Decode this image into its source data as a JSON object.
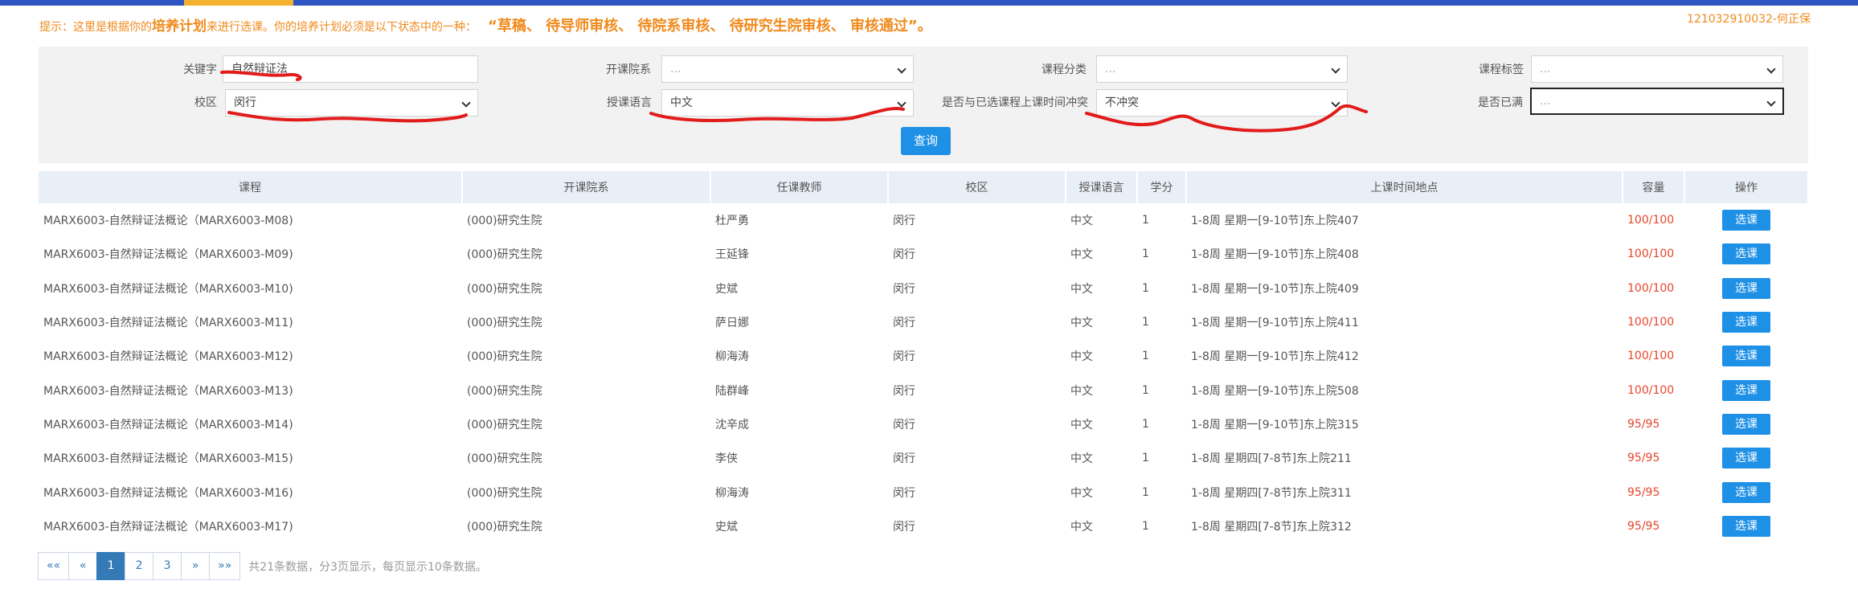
{
  "hint": {
    "prefix": "提示：这里是根据你的",
    "plan": "培养计划",
    "middle": "来进行选课。你的培养计划必须是以下状态中的一种：",
    "states": "“草稿、 待导师审核、 待院系审核、 待研究生院审核、 审核通过”。"
  },
  "user": "121032910032-何正保",
  "filters": {
    "keyword_label": "关键字",
    "keyword_value": "自然辩证法",
    "dept_label": "开课院系",
    "dept_value": "...",
    "category_label": "课程分类",
    "category_value": "...",
    "tag_label": "课程标签",
    "tag_value": "...",
    "campus_label": "校区",
    "campus_value": "闵行",
    "lang_label": "授课语言",
    "lang_value": "中文",
    "conflict_label": "是否与已选课程上课时间冲突",
    "conflict_value": "不冲突",
    "full_label": "是否已满",
    "full_value": "...",
    "query_button": "查询"
  },
  "table": {
    "headers": [
      "课程",
      "开课院系",
      "任课教师",
      "校区",
      "授课语言",
      "学分",
      "上课时间地点",
      "容量",
      "操作"
    ],
    "rows": [
      {
        "course": "MARX6003-自然辩证法概论（MARX6003-M08)",
        "dept": "(000)研究生院",
        "teacher": "杜严勇",
        "campus": "闵行",
        "lang": "中文",
        "credit": "1",
        "time": "1-8周 星期一[9-10节]东上院407",
        "cap": "100/100",
        "action": "选课"
      },
      {
        "course": "MARX6003-自然辩证法概论（MARX6003-M09)",
        "dept": "(000)研究生院",
        "teacher": "王延锋",
        "campus": "闵行",
        "lang": "中文",
        "credit": "1",
        "time": "1-8周 星期一[9-10节]东上院408",
        "cap": "100/100",
        "action": "选课"
      },
      {
        "course": "MARX6003-自然辩证法概论（MARX6003-M10)",
        "dept": "(000)研究生院",
        "teacher": "史斌",
        "campus": "闵行",
        "lang": "中文",
        "credit": "1",
        "time": "1-8周 星期一[9-10节]东上院409",
        "cap": "100/100",
        "action": "选课"
      },
      {
        "course": "MARX6003-自然辩证法概论（MARX6003-M11)",
        "dept": "(000)研究生院",
        "teacher": "萨日娜",
        "campus": "闵行",
        "lang": "中文",
        "credit": "1",
        "time": "1-8周 星期一[9-10节]东上院411",
        "cap": "100/100",
        "action": "选课"
      },
      {
        "course": "MARX6003-自然辩证法概论（MARX6003-M12)",
        "dept": "(000)研究生院",
        "teacher": "柳海涛",
        "campus": "闵行",
        "lang": "中文",
        "credit": "1",
        "time": "1-8周 星期一[9-10节]东上院412",
        "cap": "100/100",
        "action": "选课"
      },
      {
        "course": "MARX6003-自然辩证法概论（MARX6003-M13)",
        "dept": "(000)研究生院",
        "teacher": "陆群峰",
        "campus": "闵行",
        "lang": "中文",
        "credit": "1",
        "time": "1-8周 星期一[9-10节]东上院508",
        "cap": "100/100",
        "action": "选课"
      },
      {
        "course": "MARX6003-自然辩证法概论（MARX6003-M14)",
        "dept": "(000)研究生院",
        "teacher": "沈辛成",
        "campus": "闵行",
        "lang": "中文",
        "credit": "1",
        "time": "1-8周 星期一[9-10节]东上院315",
        "cap": "95/95",
        "action": "选课"
      },
      {
        "course": "MARX6003-自然辩证法概论（MARX6003-M15)",
        "dept": "(000)研究生院",
        "teacher": "李侠",
        "campus": "闵行",
        "lang": "中文",
        "credit": "1",
        "time": "1-8周 星期四[7-8节]东上院211",
        "cap": "95/95",
        "action": "选课"
      },
      {
        "course": "MARX6003-自然辩证法概论（MARX6003-M16)",
        "dept": "(000)研究生院",
        "teacher": "柳海涛",
        "campus": "闵行",
        "lang": "中文",
        "credit": "1",
        "time": "1-8周 星期四[7-8节]东上院311",
        "cap": "95/95",
        "action": "选课"
      },
      {
        "course": "MARX6003-自然辩证法概论（MARX6003-M17)",
        "dept": "(000)研究生院",
        "teacher": "史斌",
        "campus": "闵行",
        "lang": "中文",
        "credit": "1",
        "time": "1-8周 星期四[7-8节]东上院312",
        "cap": "95/95",
        "action": "选课"
      }
    ]
  },
  "pager": {
    "first": "««",
    "prev": "«",
    "pages": [
      "1",
      "2",
      "3"
    ],
    "next": "»",
    "last": "»»",
    "info": "共21条数据，分3页显示，每页显示10条数据。"
  },
  "colors": {
    "accent": "#1e90e6",
    "hint": "#f08a1c",
    "capacity": "#e8452c",
    "annotation": "#e21b1b"
  }
}
